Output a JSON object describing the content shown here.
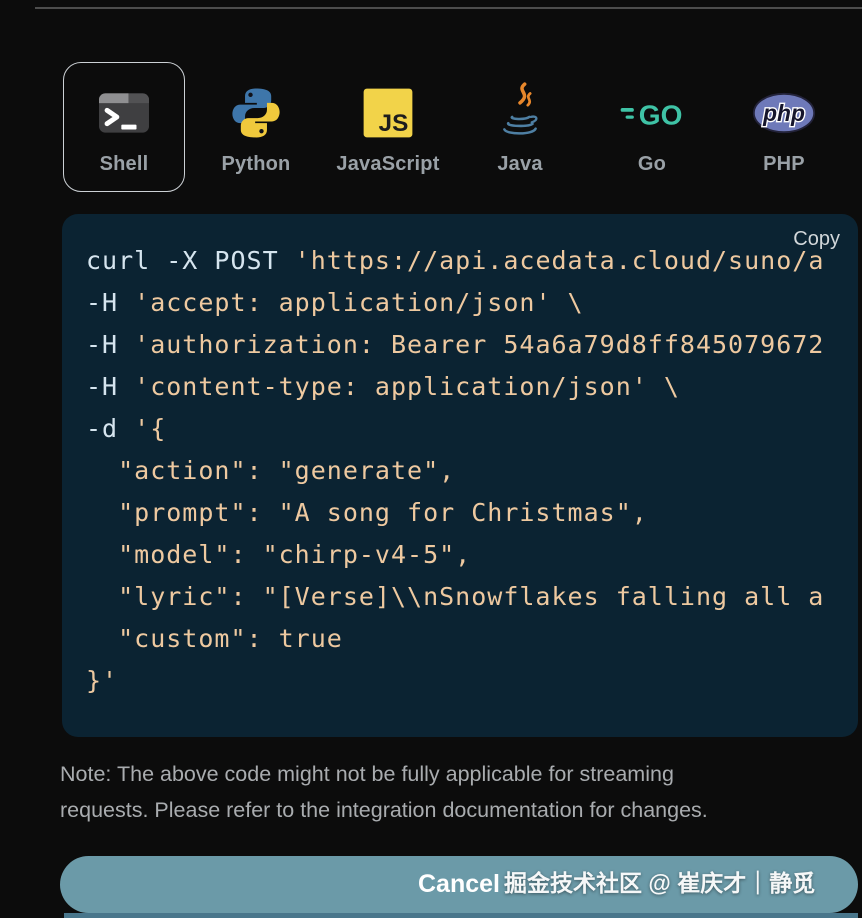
{
  "dialog": {
    "tabs": [
      {
        "label": "Shell",
        "icon": "shell-terminal-icon",
        "selected": true
      },
      {
        "label": "Python",
        "icon": "python-icon",
        "selected": false
      },
      {
        "label": "JavaScript",
        "icon": "javascript-icon",
        "selected": false
      },
      {
        "label": "Java",
        "icon": "java-icon",
        "selected": false
      },
      {
        "label": "Go",
        "icon": "go-icon",
        "selected": false
      },
      {
        "label": "PHP",
        "icon": "php-icon",
        "selected": false
      }
    ],
    "code_block": {
      "copy_label": "Copy",
      "lines": [
        [
          {
            "t": "curl -X POST ",
            "c": "cmd"
          },
          {
            "t": "'https://api.acedata.cloud/suno/a",
            "c": "str"
          }
        ],
        [
          {
            "t": "-H ",
            "c": "cmd"
          },
          {
            "t": "'accept: application/json' \\",
            "c": "str"
          }
        ],
        [
          {
            "t": "-H ",
            "c": "cmd"
          },
          {
            "t": "'authorization: Bearer 54a6a79d8ff845079672",
            "c": "str"
          }
        ],
        [
          {
            "t": "-H ",
            "c": "cmd"
          },
          {
            "t": "'content-type: application/json' \\",
            "c": "str"
          }
        ],
        [
          {
            "t": "-d ",
            "c": "cmd"
          },
          {
            "t": "'{",
            "c": "str"
          }
        ],
        [
          {
            "t": "  \"action\": \"generate\",",
            "c": "str"
          }
        ],
        [
          {
            "t": "  \"prompt\": \"A song for Christmas\",",
            "c": "str"
          }
        ],
        [
          {
            "t": "  \"model\": \"chirp-v4-5\",",
            "c": "str"
          }
        ],
        [
          {
            "t": "  \"lyric\": \"[Verse]\\\\nSnowflakes falling all a",
            "c": "str"
          }
        ],
        [
          {
            "t": "  \"custom\": true",
            "c": "str"
          }
        ],
        [
          {
            "t": "}'",
            "c": "str"
          }
        ]
      ]
    },
    "note_lines": [
      "Note: The above code might not be fully applicable for streaming",
      "requests. Please refer to the integration documentation for changes."
    ],
    "footer": {
      "cancel_label": "Cancel",
      "watermark": "掘金技术社区 @ 崔庆才｜静觅"
    },
    "colors": {
      "code_background": "#0b2332",
      "code_command": "#d6e5ef",
      "code_string": "#eec9a0",
      "cancel_button": "#6b9aa8",
      "tab_label": "#9aa1a7",
      "javascript_yellow": "#f2d349",
      "go_teal": "#3fc3a6",
      "php_purple": "#6e79b9",
      "java_orange": "#e8872b",
      "python_blue": "#3e76aa",
      "python_yellow": "#f0c93c"
    }
  }
}
